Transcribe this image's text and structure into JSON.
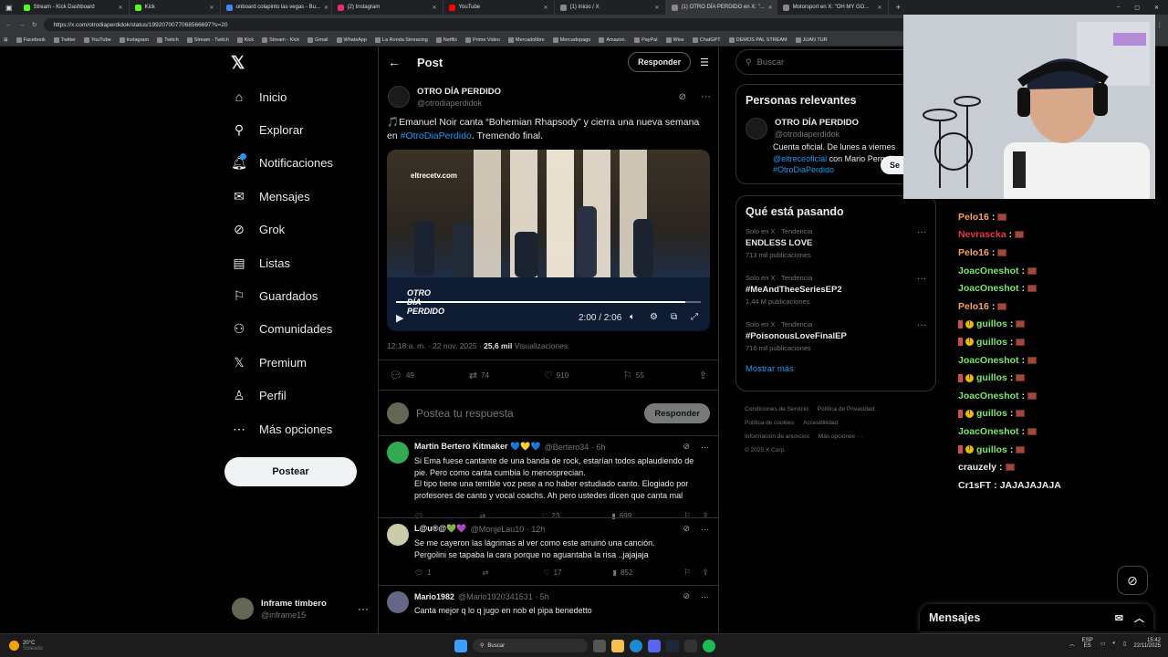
{
  "browser": {
    "tabs": [
      {
        "label": "Stream - Kick Dashboard",
        "color": "#53fc18"
      },
      {
        "label": "Kick",
        "color": "#53fc18"
      },
      {
        "label": "onboard colapinto las vegas - Bu...",
        "color": "#4285f4"
      },
      {
        "label": "(2) Instagram",
        "color": "#e1306c"
      },
      {
        "label": "YouTube",
        "color": "#ff0000"
      },
      {
        "label": "(1) Inicio / X",
        "color": "#888888"
      },
      {
        "label": "(1) OTRO DÍA PERDIDO en X: \"...",
        "color": "#888888"
      },
      {
        "label": "Motorsport en X: \"OH MY GO...",
        "color": "#888888"
      }
    ],
    "url": "https://x.com/otrodiaperdidok/status/1992070077068566697?s=20",
    "bookmarks": [
      "Facebook",
      "Twitter",
      "YouTube",
      "Instagram",
      "Twitch",
      "Stream - Twitch",
      "Kick",
      "Stream - Kick",
      "Gmail",
      "WhatsApp",
      "La Ronda Simracing",
      "Netflix",
      "Prime Video",
      "Mercadolibre",
      "Mercadopago",
      "Amazon.",
      "PayPal",
      "Wise",
      "ChatGPT",
      "DEMOS PAL STREAM",
      "JUAN TUR"
    ]
  },
  "nav": {
    "items": [
      {
        "label": "Inicio",
        "icon": "home-icon",
        "glyph": "⌂"
      },
      {
        "label": "Explorar",
        "icon": "search-icon",
        "glyph": "⚲"
      },
      {
        "label": "Notificaciones",
        "icon": "bell-icon",
        "glyph": "🔔︎"
      },
      {
        "label": "Mensajes",
        "icon": "mail-icon",
        "glyph": "✉"
      },
      {
        "label": "Grok",
        "icon": "grok-icon",
        "glyph": "⊘"
      },
      {
        "label": "Listas",
        "icon": "list-icon",
        "glyph": "▤"
      },
      {
        "label": "Guardados",
        "icon": "bookmark-icon",
        "glyph": "⚐"
      },
      {
        "label": "Comunidades",
        "icon": "people-icon",
        "glyph": "⚇"
      },
      {
        "label": "Premium",
        "icon": "x-logo-icon",
        "glyph": "𝕏"
      },
      {
        "label": "Perfil",
        "icon": "person-icon",
        "glyph": "♙"
      },
      {
        "label": "Más opciones",
        "icon": "more-circle-icon",
        "glyph": "⋯"
      }
    ],
    "post_button": "Postear",
    "account_name": "Inframe timbero",
    "account_handle": "@inframe15",
    "logo": "𝕏"
  },
  "post": {
    "header_title": "Post",
    "reply_button": "Responder",
    "author_name": "OTRO DÍA PERDIDO",
    "author_handle": "@otrodiaperdidok",
    "text_part1": "🎵Emanuel Noir canta “Bohemian Rhapsody” y cierra una nueva semana en ",
    "hashtag": "#OtroDiaPerdido",
    "text_part2": ". Tremendo final.",
    "video_watermark": "eltrecetv.com",
    "video_overlay": "OTRO DÍA PERDIDO",
    "video_time": "2:00 / 2:06",
    "video_progress": 0.95,
    "timestamp": "12:18 a. m. · 22 nov. 2025 · ",
    "views_count": "25,6 mil",
    "views_label": " Visualizaciones",
    "stats": {
      "replies": "49",
      "reposts": "74",
      "likes": "910",
      "bookmarks": "55"
    },
    "reply_placeholder": "Postea tu respuesta",
    "reply_submit": "Responder"
  },
  "replies": [
    {
      "name": "Martin Bertero Kitmaker 💙💛💙",
      "handle": "@Bertero34 · 6h",
      "text": "Si Ema fuese cantante de una banda de rock, estarían todos  aplaudiendo de pie. Pero como canta cumbia lo menosprecian.\nEl tipo tiene una terrible voz pese a no haber estudiado canto. Elogiado por profesores de canto y vocal coachs. Ah pero ustedes dicen que canta mal",
      "replies": "",
      "reposts": "",
      "likes": "23",
      "views": "699"
    },
    {
      "name": "L@u®@💚💜",
      "handle": "@MonjeLau10 · 12h",
      "text": "Se me cayeron las lágrimas al ver como este arruinó una canción.\nPergolini se tapaba la cara porque no aguantaba la risa  ..jajajaja",
      "replies": "1",
      "reposts": "",
      "likes": "17",
      "views": "852"
    },
    {
      "name": "Mario1982",
      "handle": "@Mario1920341531 · 5h",
      "text": "Canta mejor q lo q jugo en nob el pipa benedetto",
      "replies": "",
      "reposts": "",
      "likes": "",
      "views": ""
    }
  ],
  "right": {
    "search_placeholder": "Buscar",
    "relevant_title": "Personas relevantes",
    "relevant_name": "OTRO DÍA PERDIDO",
    "relevant_handle": "@otrodiaperdidok",
    "relevant_follow": "Se",
    "relevant_bio_1": "Cuenta oficial. De lunes a viernes",
    "relevant_bio_link1": "@eltreceoficial",
    "relevant_bio_2": " con Mario Pergolin",
    "relevant_bio_link2": "#OtroDiaPerdido",
    "trends_title": "Qué está pasando",
    "trends": [
      {
        "context": "Solo en X · Tendencia",
        "name": "ENDLESS LOVE",
        "count": "713 mil publicaciones"
      },
      {
        "context": "Solo en X · Tendencia",
        "name": "#MeAndTheeSeriesEP2",
        "count": "1,44 M publicaciones"
      },
      {
        "context": "Solo en X · Tendencia",
        "name": "#PoisonousLoveFinalEP",
        "count": "716 mil publicaciones"
      }
    ],
    "show_more": "Mostrar más",
    "footer": [
      "Condiciones de Servicio",
      "Política de Privacidad",
      "Política de cookies",
      "Accesibilidad",
      "Información de anuncios",
      "Más opciones ···",
      "© 2025 X Corp."
    ]
  },
  "chat": [
    {
      "user": "Pelo16",
      "color": "#f4a261",
      "badge": false,
      "msg": ""
    },
    {
      "user": "Nevrascka",
      "color": "#e63946",
      "badge": false,
      "msg": ""
    },
    {
      "user": "Pelo16",
      "color": "#f4a261",
      "badge": false,
      "msg": ""
    },
    {
      "user": "JoacOneshot",
      "color": "#7ee36e",
      "badge": false,
      "msg": ""
    },
    {
      "user": "JoacOneshot",
      "color": "#7ee36e",
      "badge": false,
      "msg": ""
    },
    {
      "user": "Pelo16",
      "color": "#f4a261",
      "badge": false,
      "msg": ""
    },
    {
      "user": "guillos",
      "color": "#7ee36e",
      "badge": true,
      "msg": ""
    },
    {
      "user": "guillos",
      "color": "#7ee36e",
      "badge": true,
      "msg": ""
    },
    {
      "user": "JoacOneshot",
      "color": "#7ee36e",
      "badge": false,
      "msg": ""
    },
    {
      "user": "guillos",
      "color": "#7ee36e",
      "badge": true,
      "msg": ""
    },
    {
      "user": "JoacOneshot",
      "color": "#7ee36e",
      "badge": false,
      "msg": ""
    },
    {
      "user": "guillos",
      "color": "#7ee36e",
      "badge": true,
      "msg": ""
    },
    {
      "user": "JoacOneshot",
      "color": "#7ee36e",
      "badge": false,
      "msg": ""
    },
    {
      "user": "guillos",
      "color": "#7ee36e",
      "badge": true,
      "msg": ""
    },
    {
      "user": "crauzely",
      "color": "#e7e9ea",
      "badge": false,
      "msg": ""
    },
    {
      "user": "Cr1sFT",
      "color": "#e7e9ea",
      "badge": false,
      "msg": "JAJAJAJAJA"
    }
  ],
  "dm_panel": {
    "title": "Mensajes"
  },
  "taskbar": {
    "weather_temp": "20°C",
    "weather_desc": "Soleado",
    "search_placeholder": "Buscar",
    "lang_1": "ESP",
    "lang_2": "ES",
    "time": "15:42",
    "date": "22/11/2025"
  },
  "colors": {
    "accent": "#1d9bf0",
    "bg": "#000000",
    "border": "#2f3336",
    "kick_green": "#53fc18"
  }
}
